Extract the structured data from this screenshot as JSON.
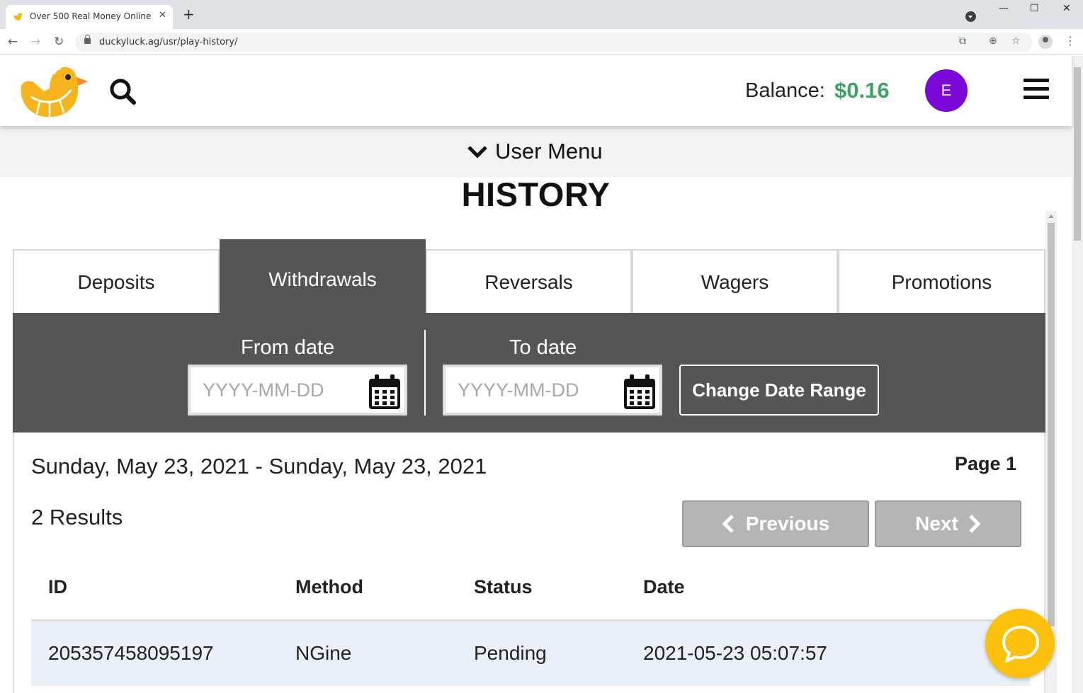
{
  "browser": {
    "tab_title": "Over 500 Real Money Online Casi",
    "tab_close": "✕",
    "new_tab": "+",
    "url": "duckyluck.ag/usr/play-history/",
    "window_controls": {
      "minimize": "—",
      "maximize": "☐",
      "close": "✕"
    }
  },
  "header": {
    "balance_label": "Balance:",
    "balance_value": "$0.16",
    "avatar_initial": "E"
  },
  "user_menu": {
    "label": "User Menu"
  },
  "page_title": "HISTORY",
  "tabs": [
    {
      "label": "Deposits",
      "active": false
    },
    {
      "label": "Withdrawals",
      "active": true
    },
    {
      "label": "Reversals",
      "active": false
    },
    {
      "label": "Wagers",
      "active": false
    },
    {
      "label": "Promotions",
      "active": false
    }
  ],
  "filter": {
    "from_label": "From date",
    "from_placeholder": "YYYY-MM-DD",
    "to_label": "To date",
    "to_placeholder": "YYYY-MM-DD",
    "change_button": "Change Date Range"
  },
  "results": {
    "date_range": "Sunday, May 23, 2021 - Sunday, May 23, 2021",
    "page_label": "Page 1",
    "count_label": "2 Results",
    "previous_label": "Previous",
    "next_label": "Next"
  },
  "table": {
    "headers": [
      "ID",
      "Method",
      "Status",
      "Date"
    ],
    "rows": [
      [
        "205357458095197",
        "NGine",
        "Pending",
        "2021-05-23 05:07:57"
      ]
    ]
  },
  "colors": {
    "balance": "#3fa267",
    "avatar": "#7b08d6",
    "panel": "#555555",
    "chat": "#fcc10d",
    "row_highlight": "#eaf0f8"
  }
}
